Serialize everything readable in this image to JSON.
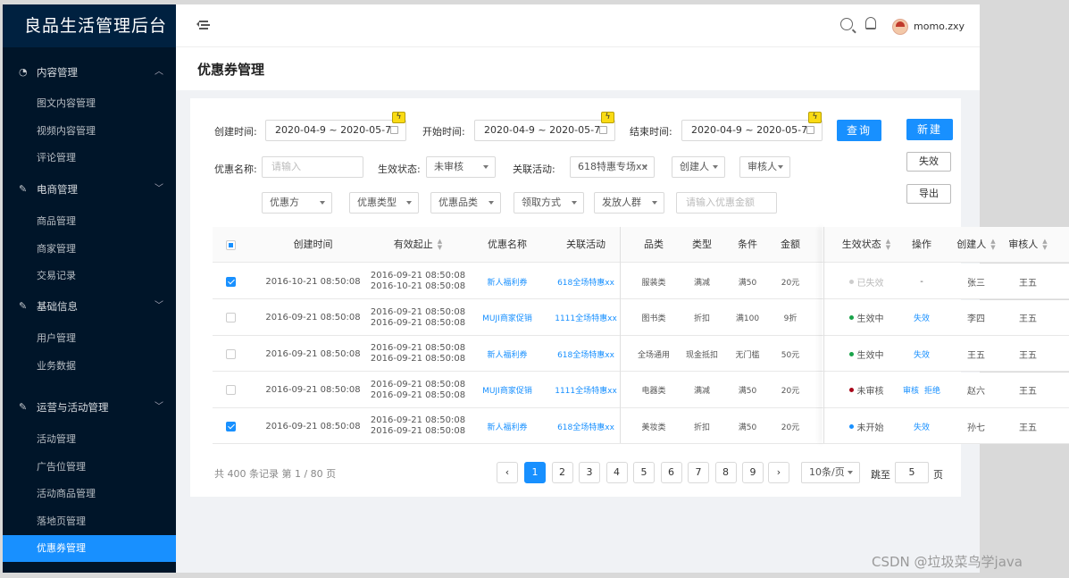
{
  "app": {
    "title": "良品生活管理后台"
  },
  "sidebar": {
    "groups": [
      {
        "label": "内容管理",
        "icon": "dashboard-icon",
        "expanded": true,
        "items": [
          "图文内容管理",
          "视频内容管理",
          "评论管理"
        ]
      },
      {
        "label": "电商管理",
        "icon": "edit-icon",
        "expanded": false,
        "items": [
          "商品管理",
          "商家管理",
          "交易记录"
        ]
      },
      {
        "label": "基础信息",
        "icon": "edit-icon",
        "expanded": false,
        "items": [
          "用户管理",
          "业务数据"
        ]
      },
      {
        "label": "运营与活动管理",
        "icon": "edit-icon",
        "expanded": false,
        "items": [
          "活动管理",
          "广告位管理",
          "活动商品管理",
          "落地页管理",
          "优惠券管理"
        ]
      }
    ],
    "active_item": "优惠券管理"
  },
  "topbar": {
    "username": "momo.zxy"
  },
  "page": {
    "title": "优惠券管理"
  },
  "filters": {
    "created_label": "创建时间:",
    "created_value": "2020-04-9 ~ 2020-05-7",
    "start_label": "开始时间:",
    "start_value": "2020-04-9 ~ 2020-05-7",
    "end_label": "结束时间:",
    "end_value": "2020-04-9 ~ 2020-05-7",
    "query_button": "查询",
    "new_button": "新建",
    "name_label": "优惠名称:",
    "name_placeholder": "请输入",
    "status_label": "生效状态:",
    "status_value": "未审核",
    "activity_label": "关联活动:",
    "activity_value": "618特惠专场xx",
    "creator_select": "创建人",
    "reviewer_select": "审核人",
    "invalidate_button": "失效",
    "export_button": "导出",
    "row3": [
      "优惠方",
      "优惠类型",
      "优惠品类",
      "领取方式",
      "发放人群"
    ],
    "amount_placeholder": "请输入优惠金额"
  },
  "table": {
    "headers": [
      "创建时间",
      "有效起止",
      "优惠名称",
      "关联活动",
      "品类",
      "类型",
      "条件",
      "金额",
      "生效状态",
      "操作",
      "创建人",
      "审核人"
    ],
    "rows": [
      {
        "checked": true,
        "created": "2016-10-21  08:50:08",
        "valid_from": "2016-09-21  08:50:08",
        "valid_to": "2016-10-21  08:50:08",
        "name": "新人福利券",
        "activity": "618全场特惠xx",
        "category": "服装类",
        "type": "满减",
        "condition": "满50",
        "amount": "20元",
        "status": "已失效",
        "status_color": "#cccccc",
        "actions": [
          "-"
        ],
        "creator": "张三",
        "reviewer": "王五"
      },
      {
        "checked": false,
        "created": "2016-09-21  08:50:08",
        "valid_from": "2016-09-21  08:50:08",
        "valid_to": "2016-09-21  08:50:08",
        "name": "MUJI商家促销",
        "activity": "1111全场特惠xx",
        "category": "图书类",
        "type": "折扣",
        "condition": "满100",
        "amount": "9折",
        "status": "生效中",
        "status_color": "#1aa34a",
        "actions": [
          "失效"
        ],
        "creator": "李四",
        "reviewer": "王五"
      },
      {
        "checked": false,
        "created": "2016-09-21  08:50:08",
        "valid_from": "2016-09-21  08:50:08",
        "valid_to": "2016-09-21  08:50:08",
        "name": "新人福利券",
        "activity": "618全场特惠xx",
        "category": "全场通用",
        "type": "现金抵扣",
        "condition": "无门槛",
        "amount": "50元",
        "status": "生效中",
        "status_color": "#1aa34a",
        "actions": [
          "失效"
        ],
        "creator": "王五",
        "reviewer": "王五"
      },
      {
        "checked": false,
        "created": "2016-09-21  08:50:08",
        "valid_from": "2016-09-21  08:50:08",
        "valid_to": "2016-09-21  08:50:08",
        "name": "MUJI商家促销",
        "activity": "1111全场特惠xx",
        "category": "电器类",
        "type": "满减",
        "condition": "满50",
        "amount": "20元",
        "status": "未审核",
        "status_color": "#a8071a",
        "actions": [
          "审核",
          "拒绝"
        ],
        "creator": "赵六",
        "reviewer": "王五"
      },
      {
        "checked": true,
        "created": "2016-09-21  08:50:08",
        "valid_from": "2016-09-21  08:50:08",
        "valid_to": "2016-09-21  08:50:08",
        "name": "新人福利券",
        "activity": "618全场特惠xx",
        "category": "美妆类",
        "type": "折扣",
        "condition": "满50",
        "amount": "20元",
        "status": "未开始",
        "status_color": "#1890ff",
        "actions": [
          "失效"
        ],
        "creator": "孙七",
        "reviewer": "王五"
      }
    ]
  },
  "pagination": {
    "total_text": "共 400 条记录 第 1 / 80 页",
    "pages": [
      "1",
      "2",
      "3",
      "4",
      "5",
      "6",
      "7",
      "8",
      "9"
    ],
    "current": "1",
    "page_size": "10条/页",
    "jump_label": "跳至",
    "jump_value": "5",
    "page_suffix": "页"
  },
  "watermark": "CSDN @垃圾菜鸟学java"
}
